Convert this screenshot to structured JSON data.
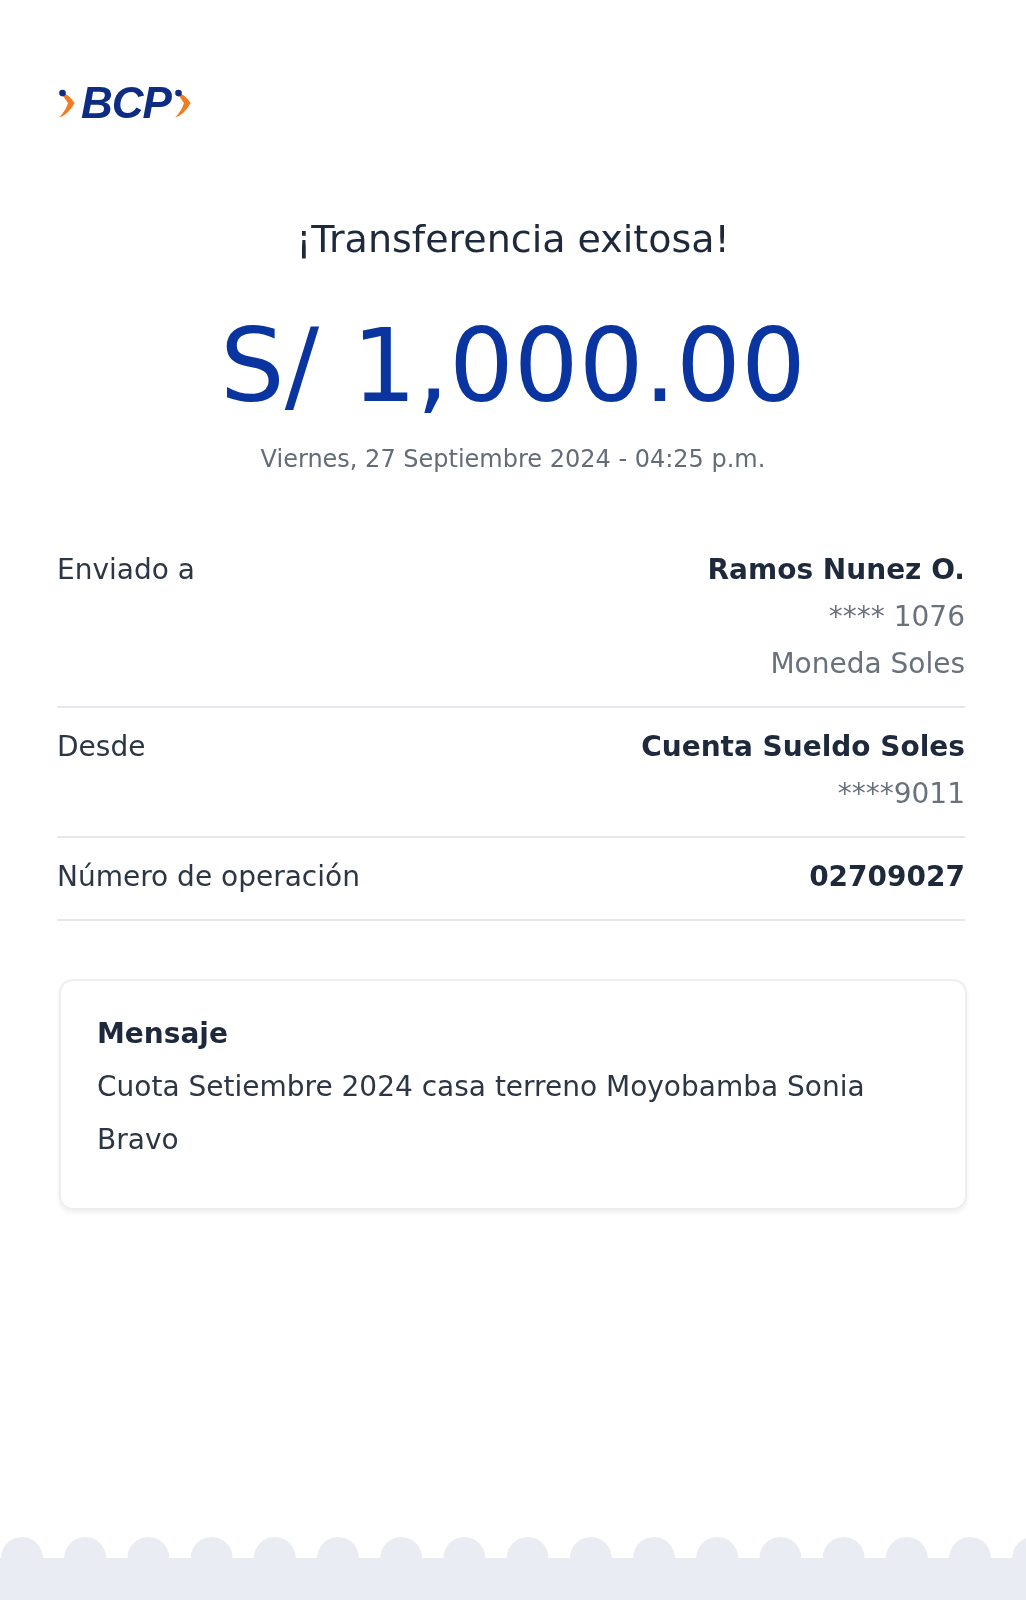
{
  "logo": {
    "text": "BCP"
  },
  "title": "¡Transferencia exitosa!",
  "amount": "S/ 1,000.00",
  "datetime": "Viernes, 27 Septiembre 2024 - 04:25 p.m.",
  "details": [
    {
      "label": "Enviado a",
      "lines": [
        {
          "text": "Ramos Nunez O.",
          "kind": "strong"
        },
        {
          "text": "**** 1076",
          "kind": "muted"
        },
        {
          "text": "Moneda Soles",
          "kind": "muted"
        }
      ]
    },
    {
      "label": "Desde",
      "lines": [
        {
          "text": "Cuenta Sueldo Soles",
          "kind": "strong"
        },
        {
          "text": "****9011",
          "kind": "muted"
        }
      ]
    },
    {
      "label": "Número de operación",
      "lines": [
        {
          "text": "02709027",
          "kind": "strong"
        }
      ]
    }
  ],
  "message": {
    "heading": "Mensaje",
    "text": "Cuota Setiembre 2024 casa terreno Moyobamba Sonia Bravo"
  }
}
